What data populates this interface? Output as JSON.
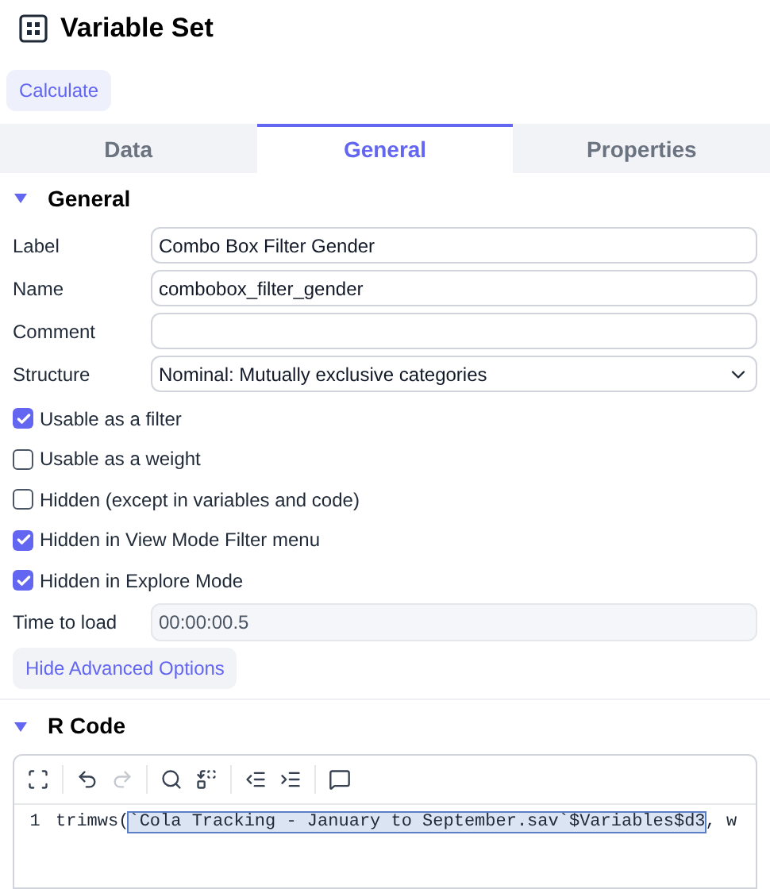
{
  "header": {
    "title": "Variable Set"
  },
  "calculate_button": "Calculate",
  "tabs": [
    {
      "label": "Data",
      "selected": false
    },
    {
      "label": "General",
      "selected": true
    },
    {
      "label": "Properties",
      "selected": false
    }
  ],
  "general": {
    "heading": "General",
    "expanded": true,
    "fields": [
      {
        "kind": "text",
        "label": "Label",
        "value": "Combo Box Filter Gender"
      },
      {
        "kind": "text",
        "label": "Name",
        "value": "combobox_filter_gender"
      },
      {
        "kind": "text",
        "label": "Comment"
      },
      {
        "kind": "select",
        "label": "Structure",
        "value": "Nominal: Mutually exclusive categories"
      }
    ],
    "checkboxes": [
      {
        "label": "Usable as a filter",
        "checked": true
      },
      {
        "label": "Usable as a weight",
        "checked": false
      },
      {
        "label": "Hidden (except in variables and code)",
        "checked": false
      },
      {
        "label": "Hidden in View Mode Filter menu",
        "checked": true
      },
      {
        "label": "Hidden in Explore Mode",
        "checked": true
      }
    ],
    "time_to_load": {
      "label": "Time to load",
      "value": "00:00:00.5",
      "disabled": true
    },
    "advanced_button": "Hide Advanced Options"
  },
  "r_code": {
    "heading": "R Code",
    "expanded": true,
    "lines": [
      {
        "number": "1",
        "parts": [
          {
            "text": "trimws(",
            "selected": false
          },
          {
            "text": "`Cola Tracking - January to September.sav`$Variables$d3",
            "selected": true
          },
          {
            "text": ", w",
            "selected": false
          }
        ]
      }
    ]
  }
}
